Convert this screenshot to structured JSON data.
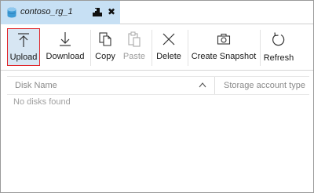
{
  "tab": {
    "title": "contoso_rg_1",
    "close_glyph": "✖",
    "icons": [
      "database-icon",
      "pin-icon",
      "close-icon"
    ]
  },
  "toolbar": {
    "buttons": [
      {
        "label": "Upload",
        "icon": "upload-icon",
        "selected": true,
        "enabled": true
      },
      {
        "label": "Download",
        "icon": "download-icon",
        "enabled": true
      },
      {
        "label": "Copy",
        "icon": "copy-icon",
        "enabled": true
      },
      {
        "label": "Paste",
        "icon": "paste-icon",
        "enabled": false
      },
      {
        "label": "Delete",
        "icon": "delete-icon",
        "enabled": true
      },
      {
        "label": "Create Snapshot",
        "icon": "camera-icon",
        "enabled": true
      },
      {
        "label": "Refresh",
        "icon": "refresh-icon",
        "enabled": true
      }
    ]
  },
  "grid": {
    "columns": [
      "Disk Name",
      "Storage account type"
    ],
    "sorted_column": "Disk Name",
    "empty_message": "No disks found"
  },
  "colors": {
    "tab_background": "#c7e0f4",
    "selected_button_background": "#d7e6f3",
    "selected_button_border": "#e0262a",
    "database_icon": "#3e9bd6"
  }
}
